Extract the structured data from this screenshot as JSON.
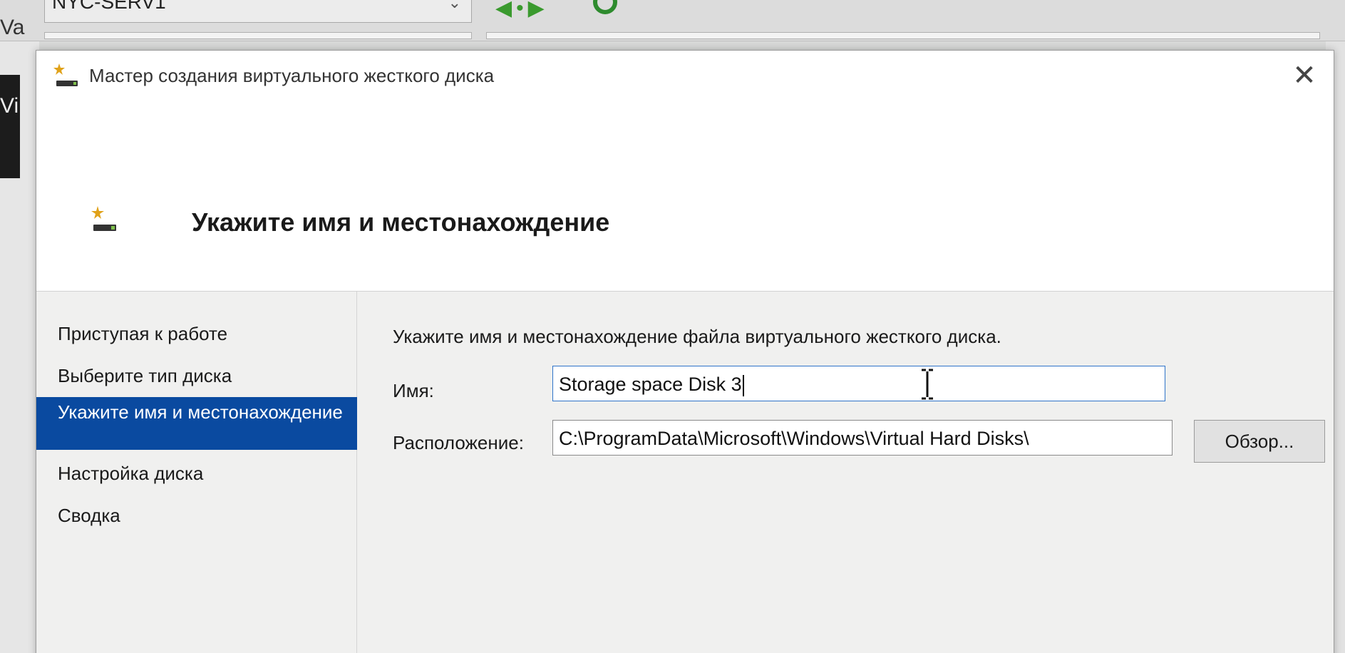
{
  "background": {
    "server_combo": "NYC-SERV1",
    "left_fragment_1": "Va",
    "left_fragment_2": "Vi"
  },
  "dialog": {
    "title": "Мастер создания виртуального жесткого диска",
    "header_title": "Укажите имя и местонахождение",
    "steps": [
      {
        "label": "Приступая к работе",
        "active": false
      },
      {
        "label": "Выберите тип диска",
        "active": false
      },
      {
        "label": "Укажите имя и местонахождение",
        "active": true
      },
      {
        "label": "Настройка диска",
        "active": false
      },
      {
        "label": "Сводка",
        "active": false
      }
    ],
    "instruction": "Укажите имя и местонахождение файла виртуального жесткого диска.",
    "name_label": "Имя:",
    "name_value": "Storage space Disk 3",
    "location_label": "Расположение:",
    "location_value": "C:\\ProgramData\\Microsoft\\Windows\\Virtual Hard Disks\\",
    "browse_label": "Обзор..."
  },
  "colors": {
    "active_step_bg": "#0a4aa0",
    "focus_border": "#2f74c9"
  },
  "icons": [
    "disk-wizard-icon",
    "close-icon",
    "text-cursor-icon",
    "back-arrow-icon",
    "refresh-icon",
    "chevron-down-icon"
  ]
}
